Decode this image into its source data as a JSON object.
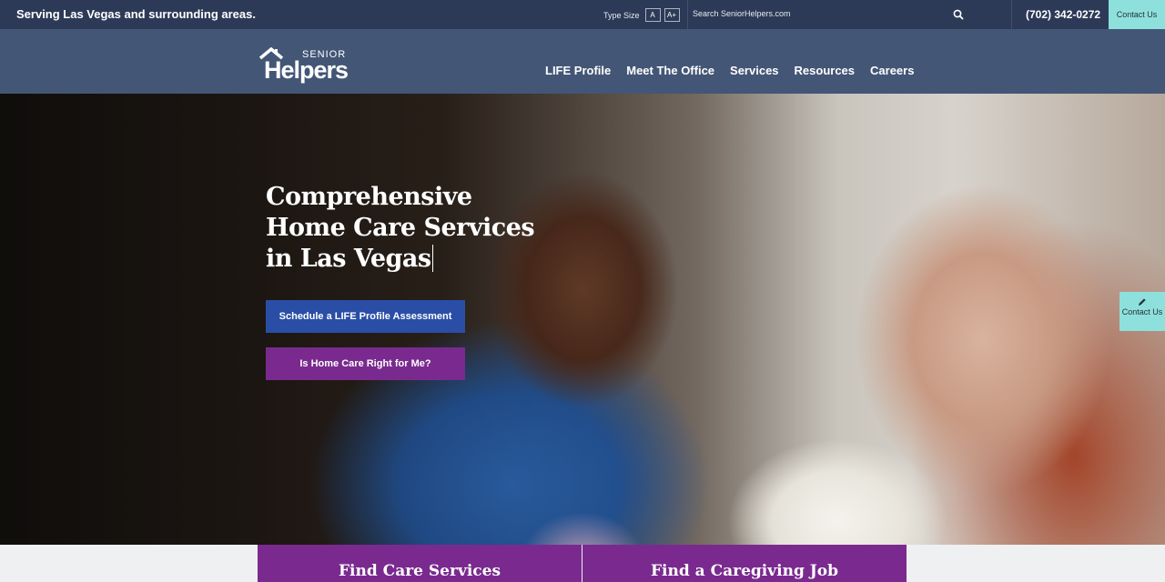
{
  "topbar": {
    "serving": "Serving Las Vegas and surrounding areas.",
    "type_size_label": "Type Size",
    "type_size_a": "A",
    "type_size_a_plus": "A+",
    "search_placeholder": "Search SeniorHelpers.com",
    "phone": "(702) 342-0272",
    "contact": "Contact Us"
  },
  "logo": {
    "senior": "SENIOR",
    "helpers": "Helpers"
  },
  "nav": {
    "items": [
      "LIFE Profile",
      "Meet The Office",
      "Services",
      "Resources",
      "Careers"
    ]
  },
  "hero": {
    "title": "Comprehensive Home Care Services in Las Vegas",
    "schedule_button": "Schedule a LIFE Profile Assessment",
    "home_care_button": "Is Home Care Right for Me?"
  },
  "side_contact": {
    "label": "Contact Us"
  },
  "bottom": {
    "find_care": "Find Care Services",
    "find_job": "Find a Caregiving Job"
  },
  "colors": {
    "topbar": "#2d3a57",
    "navbar": "#435676",
    "accent_teal": "#8ee0dd",
    "button_blue": "#2a4ea6",
    "button_purple": "#7a2a8f"
  },
  "icons": {
    "search": "search-icon",
    "pencil": "pencil-icon",
    "house": "house-logo-icon"
  }
}
